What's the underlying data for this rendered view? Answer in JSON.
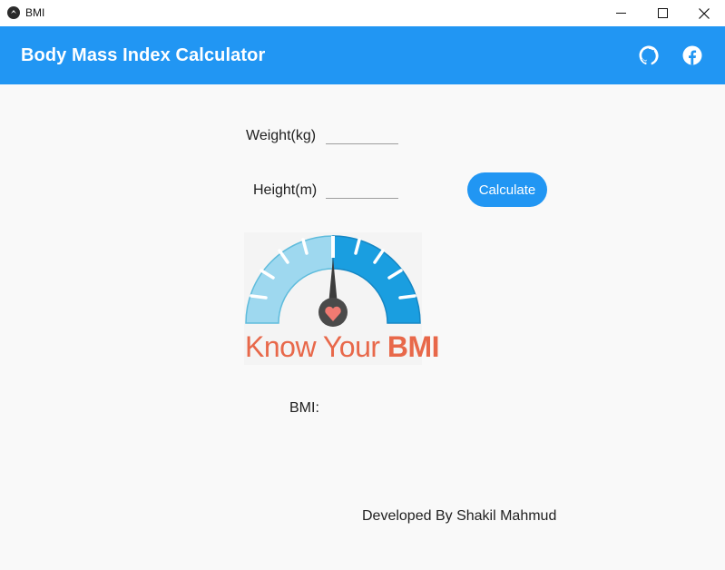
{
  "window": {
    "title": "BMI",
    "controls": [
      "minimize",
      "maximize",
      "close"
    ]
  },
  "appbar": {
    "title": "Body Mass Index Calculator",
    "actions": [
      {
        "icon": "github-icon"
      },
      {
        "icon": "facebook-icon"
      }
    ],
    "color": "#2196f3"
  },
  "form": {
    "weight_label": "Weight(kg)",
    "weight_value": "",
    "height_label": "Height(m)",
    "height_value": "",
    "calculate_label": "Calculate"
  },
  "logo": {
    "text_regular": "Know Your ",
    "text_bold": "BMI"
  },
  "result": {
    "label": "BMI:",
    "value": ""
  },
  "footer": {
    "text": "Developed By Shakil Mahmud"
  }
}
